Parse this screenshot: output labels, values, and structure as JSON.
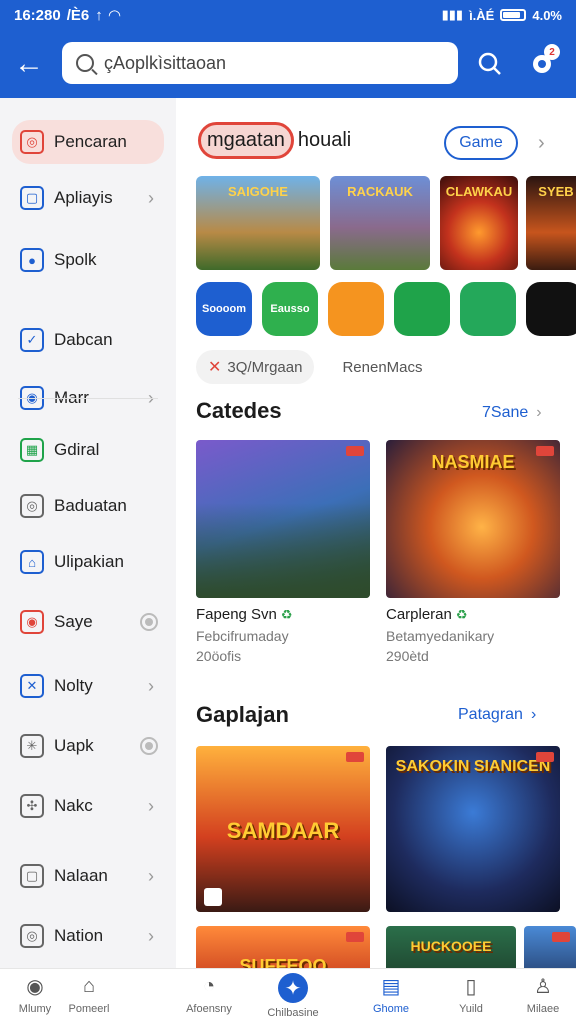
{
  "status": {
    "time": "16:280",
    "left_extra": "/È6",
    "right_text": "ì.ÀÉ",
    "battery_pct": "4.0%"
  },
  "header": {
    "search_value": "çAoplkìsittaoan",
    "notif_count": "2"
  },
  "sidebar": {
    "items": [
      {
        "label": "Pencaran",
        "icon": "target-icon",
        "color": "#e0453a",
        "trail": ""
      },
      {
        "label": "Apliayis",
        "icon": "square-icon",
        "color": "#1e5fd0",
        "trail": "chev"
      },
      {
        "label": "Spolk",
        "icon": "chat-icon",
        "color": "#1e5fd0",
        "trail": ""
      },
      {
        "label": "Dabcan",
        "icon": "check-icon",
        "color": "#1e5fd0",
        "trail": ""
      },
      {
        "label": "Marr",
        "icon": "compass-icon",
        "color": "#1e5fd0",
        "trail": "chev"
      },
      {
        "label": "Gdiral",
        "icon": "grid-icon",
        "color": "#1fa34a",
        "trail": ""
      },
      {
        "label": "Baduatan",
        "icon": "camera-icon",
        "color": "#666666",
        "trail": ""
      },
      {
        "label": "Ulipakian",
        "icon": "home-icon",
        "color": "#1e5fd0",
        "trail": ""
      },
      {
        "label": "Saye",
        "icon": "record-icon",
        "color": "#e0453a",
        "trail": "radio"
      },
      {
        "label": "Nolty",
        "icon": "tools-icon",
        "color": "#1e5fd0",
        "trail": "chev"
      },
      {
        "label": "Uapk",
        "icon": "spark-icon",
        "color": "#666666",
        "trail": "radio"
      },
      {
        "label": "Nakc",
        "icon": "puzzle-icon",
        "color": "#666666",
        "trail": "chev"
      },
      {
        "label": "Nalaan",
        "icon": "doc-icon",
        "color": "#666666",
        "trail": "chev"
      },
      {
        "label": "Nation",
        "icon": "circle-icon",
        "color": "#666666",
        "trail": "chev"
      }
    ]
  },
  "main": {
    "featured": {
      "pill": "mgaatan",
      "rest": "houali",
      "chip": "Game"
    },
    "banners": [
      "SAIGOHE",
      "RACKAUK",
      "CLAWKAU",
      "SYEB"
    ],
    "app_icons": [
      {
        "label": "Soooom",
        "color": "#1e5fd0"
      },
      {
        "label": "Eausso",
        "color": "#2fb04e"
      },
      {
        "label": "",
        "color": "#f5941f"
      },
      {
        "label": "",
        "color": "#1fa34a"
      },
      {
        "label": "",
        "color": "#24a85a"
      },
      {
        "label": "",
        "color": "#111111"
      }
    ],
    "tags": [
      "3Q/Mrgaan",
      "RenenMacs"
    ],
    "sections": [
      {
        "title": "Catedes",
        "link": "7Sane",
        "cards": [
          {
            "logo": "",
            "name": "Fapeng Svn",
            "sub1": "Febcifrumaday",
            "sub2": "20öofis"
          },
          {
            "logo": "NASMIAE",
            "name": "Carpleran",
            "sub1": "Betamyedanikary",
            "sub2": "290ètd"
          }
        ]
      },
      {
        "title": "Gaplajan",
        "link": "Patagran",
        "cards": [
          {
            "logo": "SAMDAAR"
          },
          {
            "logo": "SAKOKIN SIANICEN"
          }
        ]
      }
    ],
    "bottom_strip": [
      "SUFFEOO",
      "HUCKOOEE"
    ]
  },
  "bottom_nav": [
    {
      "label": "Mlumy",
      "icon": "compass-icon"
    },
    {
      "label": "Pomeerl",
      "icon": "home-icon"
    },
    {
      "label": "Afoensny",
      "icon": "gauge-icon"
    },
    {
      "label": "Chilbasine",
      "icon": "star-icon"
    },
    {
      "label": "Ghome",
      "icon": "book-icon",
      "active": true
    },
    {
      "label": "Yuild",
      "icon": "pages-icon"
    },
    {
      "label": "Milaee",
      "icon": "user-icon"
    }
  ],
  "colors": {
    "brand": "#1e5fd0",
    "accent": "#e0453a"
  }
}
